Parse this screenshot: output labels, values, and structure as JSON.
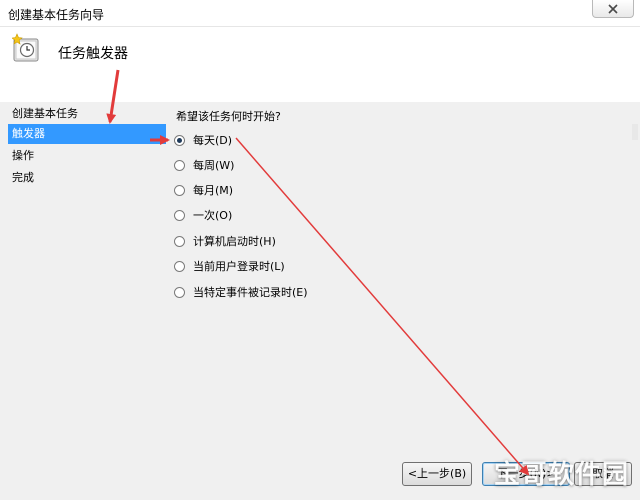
{
  "window": {
    "title": "创建基本任务向导"
  },
  "header": {
    "title": "任务触发器"
  },
  "nav": {
    "items": [
      {
        "label": "创建基本任务",
        "selected": false
      },
      {
        "label": "触发器",
        "selected": true
      },
      {
        "label": "操作",
        "selected": false
      },
      {
        "label": "完成",
        "selected": false
      }
    ]
  },
  "main": {
    "question": "希望该任务何时开始?",
    "options": [
      {
        "label": "每天(D)",
        "checked": true
      },
      {
        "label": "每周(W)",
        "checked": false
      },
      {
        "label": "每月(M)",
        "checked": false
      },
      {
        "label": "一次(O)",
        "checked": false
      },
      {
        "label": "计算机启动时(H)",
        "checked": false
      },
      {
        "label": "当前用户登录时(L)",
        "checked": false
      },
      {
        "label": "当特定事件被记录时(E)",
        "checked": false
      }
    ]
  },
  "buttons": {
    "back": "<上一步(B)",
    "next": "下一步(N)>",
    "cancel": "取消"
  },
  "watermark": "宝哥软件园",
  "colors": {
    "selection": "#3399ff",
    "annotation_arrow": "#e23b3b"
  }
}
